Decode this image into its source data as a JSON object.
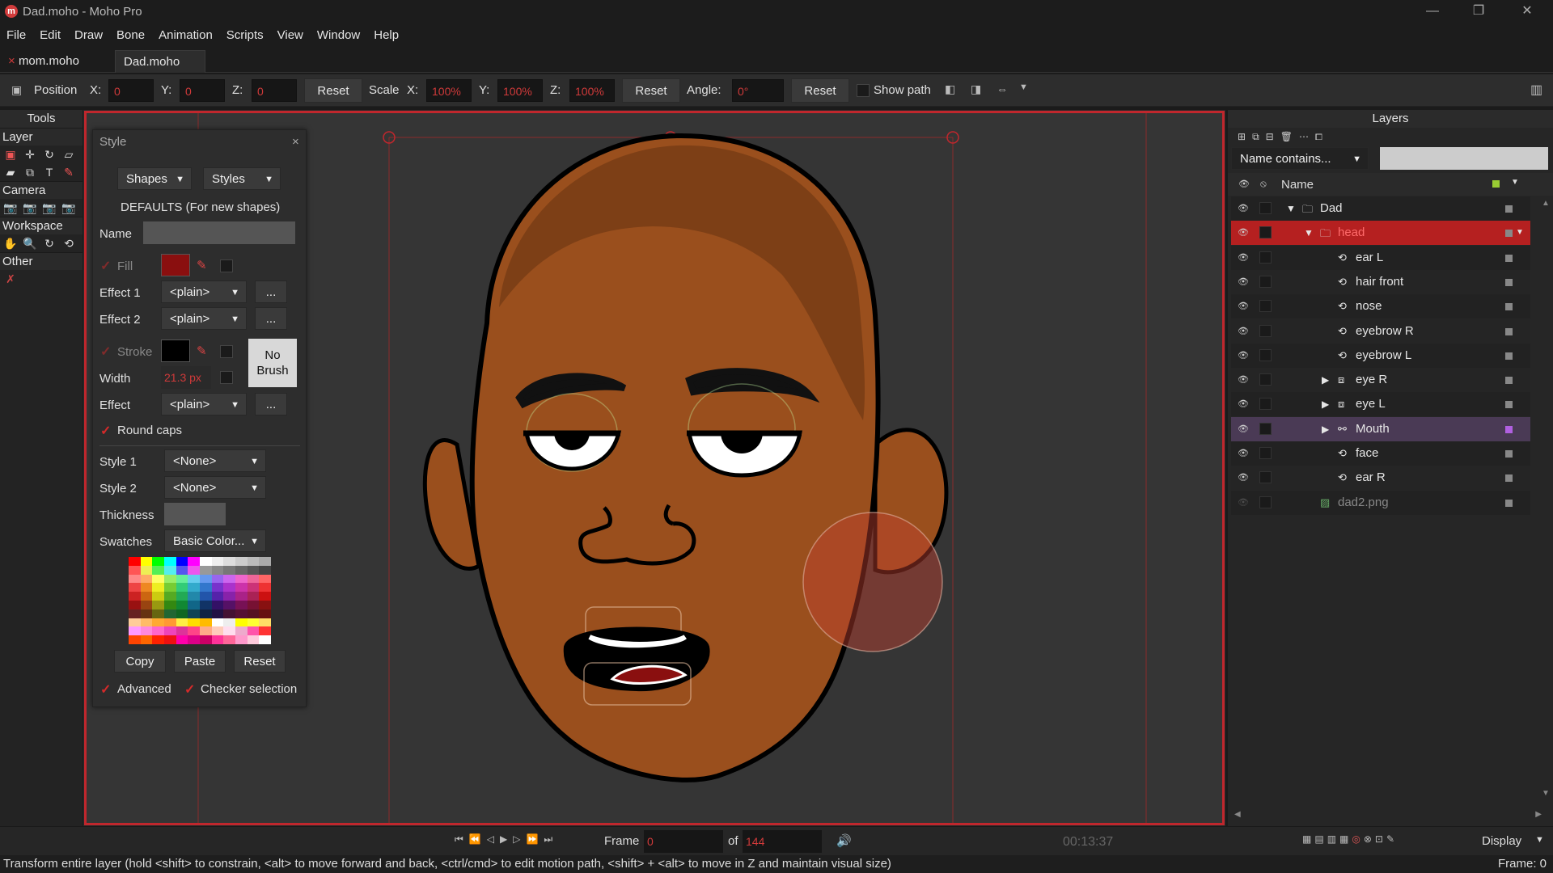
{
  "window": {
    "title": "Dad.moho - Moho Pro",
    "app_icon": "m"
  },
  "menu": [
    "File",
    "Edit",
    "Draw",
    "Bone",
    "Animation",
    "Scripts",
    "View",
    "Window",
    "Help"
  ],
  "tabs": [
    {
      "label": "mom.moho",
      "close": "×"
    },
    {
      "label": "Dad.moho"
    }
  ],
  "tool_options": {
    "position_label": "Position",
    "x_label": "X:",
    "y_label": "Y:",
    "z_label": "Z:",
    "pos_x": "0",
    "pos_y": "0",
    "pos_z": "0",
    "reset1": "Reset",
    "scale_label": "Scale",
    "scale_x": "100%",
    "scale_y": "100%",
    "scale_z": "100%",
    "reset2": "Reset",
    "angle_label": "Angle:",
    "angle": "0°",
    "reset3": "Reset",
    "show_path": "Show path"
  },
  "tools_panel": {
    "title": "Tools",
    "sections": [
      "Layer",
      "Camera",
      "Workspace",
      "Other"
    ]
  },
  "style_panel": {
    "title": "Style",
    "close": "×",
    "shapes": "Shapes",
    "styles": "Styles",
    "defaults": "DEFAULTS (For new shapes)",
    "name_label": "Name",
    "fill_label": "Fill",
    "effect1_label": "Effect 1",
    "effect1": "<plain>",
    "effect2_label": "Effect 2",
    "effect2": "<plain>",
    "more": "...",
    "stroke_label": "Stroke",
    "no_brush_1": "No",
    "no_brush_2": "Brush",
    "width_label": "Width",
    "width": "21.3 px",
    "effect_label": "Effect",
    "effect": "<plain>",
    "round_caps": "Round caps",
    "style1_label": "Style 1",
    "style1": "<None>",
    "style2_label": "Style 2",
    "style2": "<None>",
    "thickness_label": "Thickness",
    "swatches_label": "Swatches",
    "swatches": "Basic Color...",
    "copy": "Copy",
    "paste": "Paste",
    "reset": "Reset",
    "advanced": "Advanced",
    "checker": "Checker selection",
    "fill_color": "#8a0f0f",
    "stroke_color": "#000000"
  },
  "layers_panel": {
    "title": "Layers",
    "filter": "Name contains...",
    "name_header": "Name",
    "layers": [
      {
        "name": "Dad",
        "type": "group",
        "indent": 0,
        "expanded": true
      },
      {
        "name": "head",
        "type": "group",
        "indent": 1,
        "expanded": true,
        "selected": true
      },
      {
        "name": "ear L",
        "type": "vector",
        "indent": 2
      },
      {
        "name": "hair front",
        "type": "vector",
        "indent": 2
      },
      {
        "name": "nose",
        "type": "vector",
        "indent": 2
      },
      {
        "name": "eyebrow R",
        "type": "vector",
        "indent": 2
      },
      {
        "name": "eyebrow L",
        "type": "vector",
        "indent": 2
      },
      {
        "name": "eye R",
        "type": "switch",
        "indent": 2,
        "collapsed": true
      },
      {
        "name": "eye L",
        "type": "switch",
        "indent": 2,
        "collapsed": true
      },
      {
        "name": "Mouth",
        "type": "bone",
        "indent": 2,
        "collapsed": true,
        "highlight": true
      },
      {
        "name": "face",
        "type": "vector",
        "indent": 2
      },
      {
        "name": "ear R",
        "type": "vector",
        "indent": 2
      },
      {
        "name": "dad2.png",
        "type": "image",
        "indent": 1,
        "dim": true
      }
    ]
  },
  "timeline": {
    "frame_label": "Frame",
    "frame": "0",
    "of_label": "of",
    "total": "144",
    "time": "00:13:37",
    "display": "Display"
  },
  "status": {
    "text": "Transform entire layer (hold <shift> to constrain, <alt> to move forward and back, <ctrl/cmd> to edit motion path, <shift> + <alt> to move in Z and maintain visual size)",
    "frame_readout": "Frame: 0"
  },
  "colors": {
    "accent": "#c0272d",
    "skin": "#9a4f1d",
    "selected_layer": "#b52020"
  }
}
